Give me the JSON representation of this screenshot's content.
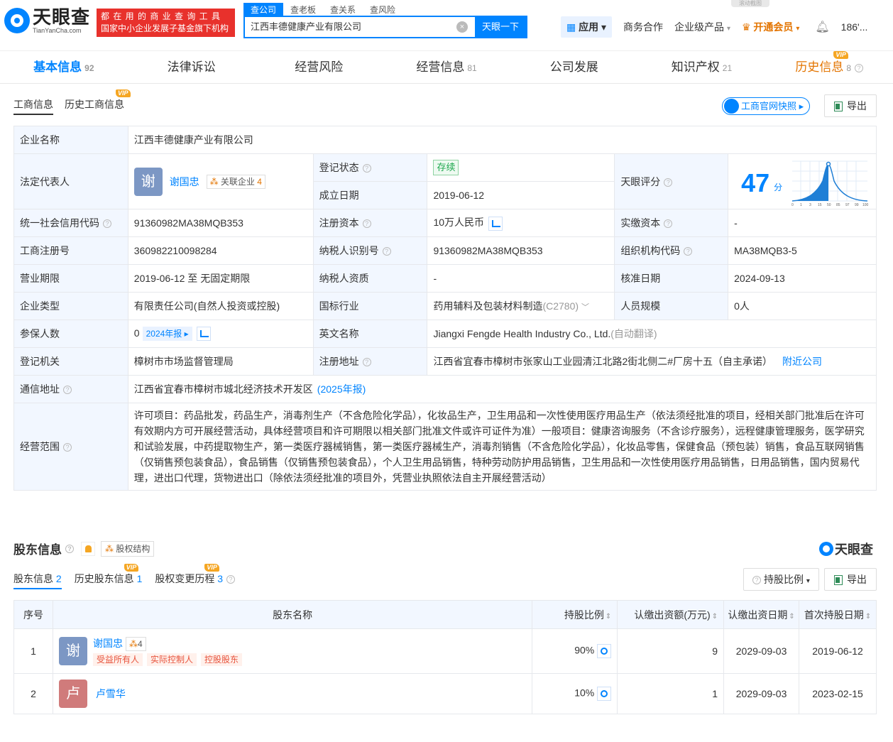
{
  "header": {
    "logo_cn": "天眼查",
    "logo_en": "TianYanCha.com",
    "slogan_line1": "都 在 用 的 商 业 查 询 工 具",
    "slogan_line2": "国家中小企业发展子基金旗下机构",
    "search_tabs": [
      "查公司",
      "查老板",
      "查关系",
      "查风险"
    ],
    "search_value": "江西丰德健康产业有限公司",
    "search_button": "天眼一下",
    "apps_label": "应用",
    "biz_coop": "商务合作",
    "enterprise_products": "企业级产品",
    "open_vip": "开通会员",
    "user": "186'...",
    "capture_tag": "滚动截图"
  },
  "main_tabs": [
    {
      "label": "基本信息",
      "count": "92"
    },
    {
      "label": "法律诉讼",
      "count": ""
    },
    {
      "label": "经营风险",
      "count": ""
    },
    {
      "label": "经营信息",
      "count": "81"
    },
    {
      "label": "公司发展",
      "count": ""
    },
    {
      "label": "知识产权",
      "count": "21"
    },
    {
      "label": "历史信息",
      "count": "8"
    }
  ],
  "vip_text": "VIP",
  "sub_tabs": [
    "工商信息",
    "历史工商信息"
  ],
  "snapshot_btn": "工商官网快照",
  "export_btn": "导出",
  "info": {
    "company_name_k": "企业名称",
    "company_name_v": "江西丰德健康产业有限公司",
    "legal_rep_k": "法定代表人",
    "legal_rep_avatar": "谢",
    "legal_rep_name": "谢国忠",
    "assoc_label": "关联企业",
    "assoc_count": "4",
    "status_k": "登记状态",
    "status_v": "存续",
    "founded_k": "成立日期",
    "founded_v": "2019-06-12",
    "score_k": "天眼评分",
    "score_v": "47",
    "score_unit": "分",
    "credit_code_k": "统一社会信用代码",
    "credit_code_v": "91360982MA38MQB353",
    "reg_capital_k": "注册资本",
    "reg_capital_v": "10万人民币",
    "paid_capital_k": "实缴资本",
    "paid_capital_v": "-",
    "reg_no_k": "工商注册号",
    "reg_no_v": "360982210098284",
    "taxpayer_id_k": "纳税人识别号",
    "taxpayer_id_v": "91360982MA38MQB353",
    "org_code_k": "组织机构代码",
    "org_code_v": "MA38MQB3-5",
    "term_k": "营业期限",
    "term_v": "2019-06-12 至 无固定期限",
    "taxpayer_qual_k": "纳税人资质",
    "taxpayer_qual_v": "-",
    "approve_date_k": "核准日期",
    "approve_date_v": "2024-09-13",
    "type_k": "企业类型",
    "type_v": "有限责任公司(自然人投资或控股)",
    "industry_k": "国标行业",
    "industry_v": "药用辅料及包装材料制造",
    "industry_code": "(C2780)",
    "staff_k": "人员规模",
    "staff_v": "0人",
    "insured_k": "参保人数",
    "insured_v": "0",
    "insured_report": "2024年报",
    "english_k": "英文名称",
    "english_v": "Jiangxi Fengde Health Industry Co., Ltd.",
    "english_note": "(自动翻译)",
    "authority_k": "登记机关",
    "authority_v": "樟树市市场监督管理局",
    "reg_addr_k": "注册地址",
    "reg_addr_v": "江西省宜春市樟树市张家山工业园清江北路2街北侧二#厂房十五（自主承诺）",
    "nearby": "附近公司",
    "mail_addr_k": "通信地址",
    "mail_addr_v": "江西省宜春市樟树市城北经济技术开发区",
    "mail_addr_report": "(2025年报)",
    "scope_k": "经营范围",
    "scope_v": "许可项目：药品批发，药品生产，消毒剂生产（不含危险化学品），化妆品生产，卫生用品和一次性使用医疗用品生产（依法须经批准的项目，经相关部门批准后在许可有效期内方可开展经营活动，具体经营项目和许可期限以相关部门批准文件或许可证件为准）一般项目：健康咨询服务（不含诊疗服务），远程健康管理服务，医学研究和试验发展，中药提取物生产，第一类医疗器械销售，第一类医疗器械生产，消毒剂销售（不含危险化学品），化妆品零售，保健食品（预包装）销售，食品互联网销售（仅销售预包装食品），食品销售（仅销售预包装食品），个人卫生用品销售，特种劳动防护用品销售，卫生用品和一次性使用医疗用品销售，日用品销售，国内贸易代理，进出口代理，货物进出口（除依法须经批准的项目外，凭营业执照依法自主开展经营活动）"
  },
  "score_chart": {
    "ticks": [
      "0",
      "1",
      "3",
      "15",
      "50",
      "85",
      "97",
      "99",
      "100"
    ]
  },
  "shareholders": {
    "title": "股东信息",
    "structure_btn": "股权结构",
    "brand": "天眼查",
    "tabs": [
      {
        "label": "股东信息",
        "count": "2"
      },
      {
        "label": "历史股东信息",
        "count": "1"
      },
      {
        "label": "股权变更历程",
        "count": "3"
      }
    ],
    "ratio_btn": "持股比例",
    "export_btn": "导出",
    "columns": [
      "序号",
      "股东名称",
      "持股比例",
      "认缴出资额(万元)",
      "认缴出资日期",
      "首次持股日期"
    ],
    "rows": [
      {
        "no": "1",
        "avatar": "谢",
        "name": "谢国忠",
        "assoc": "4",
        "roles": [
          "受益所有人",
          "实际控制人",
          "控股股东"
        ],
        "ratio": "90%",
        "amount": "9",
        "sub_date": "2029-09-03",
        "first_date": "2019-06-12"
      },
      {
        "no": "2",
        "avatar": "卢",
        "name": "卢雪华",
        "assoc": "",
        "roles": [],
        "ratio": "10%",
        "amount": "1",
        "sub_date": "2029-09-03",
        "first_date": "2023-02-15"
      }
    ]
  },
  "colors": {
    "brand": "#0084ff",
    "accent": "#e37400",
    "slogan": "#e8312c"
  }
}
